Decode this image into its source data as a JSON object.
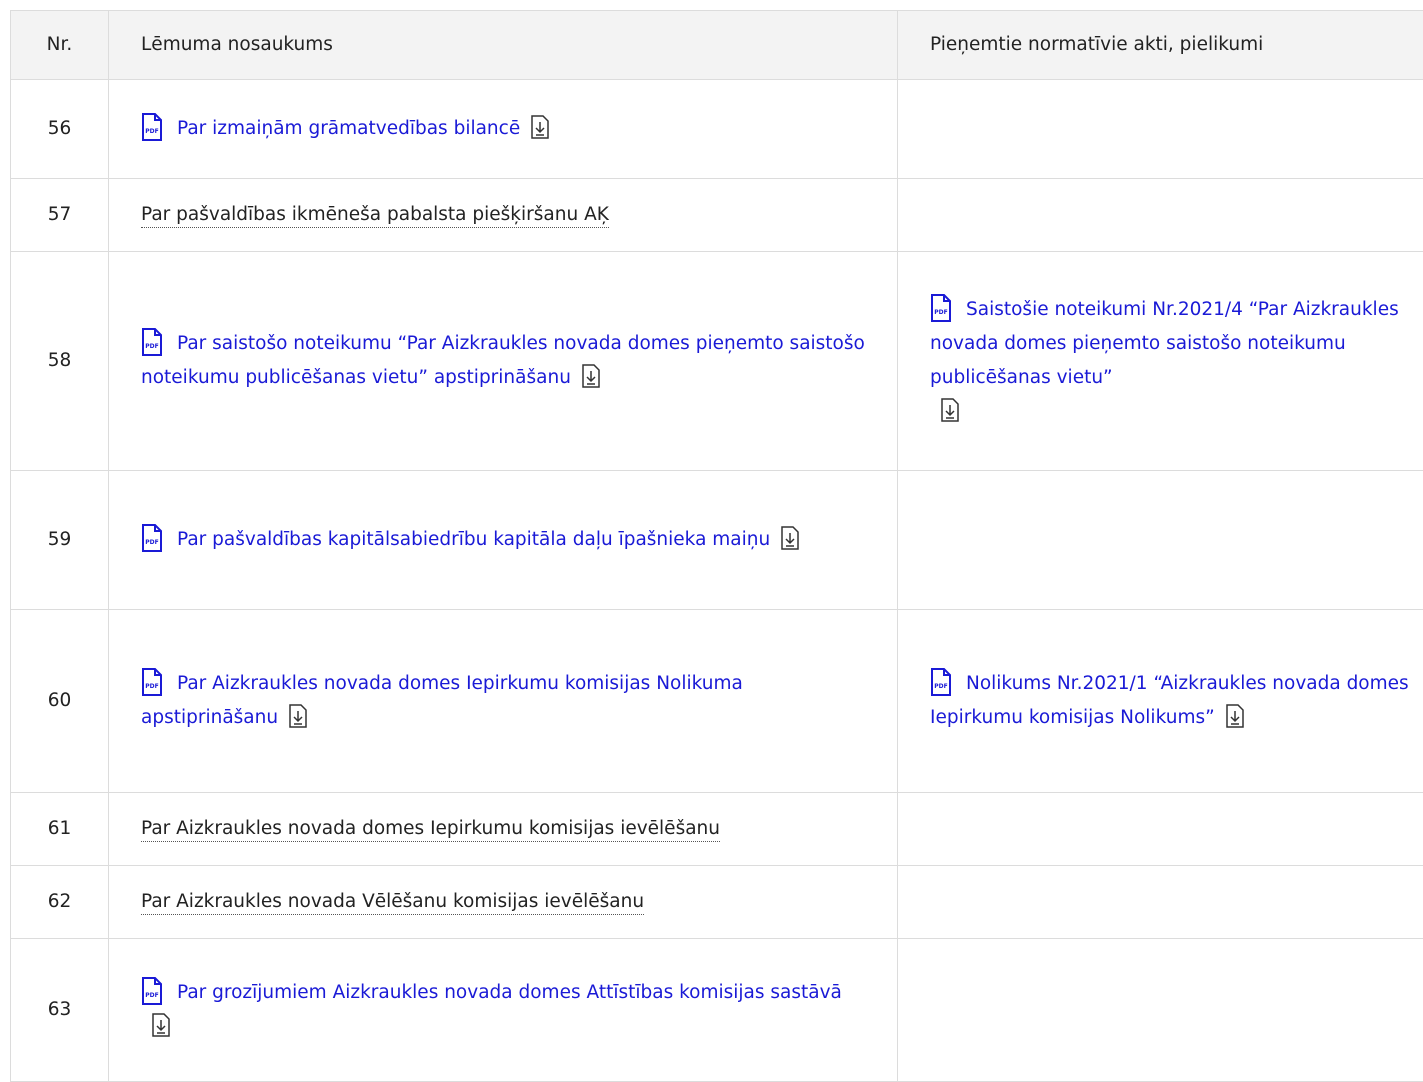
{
  "table": {
    "headers": {
      "nr": "Nr.",
      "title": "Lēmuma nosaukums",
      "attachments": "Pieņemtie normatīvie akti, pielikumi"
    },
    "rows": [
      {
        "nr": "56",
        "title": "Par izmaiņām grāmatvedības bilancē",
        "title_is_link": true,
        "attachment": ""
      },
      {
        "nr": "57",
        "title": "Par pašvaldības ikmēneša pabalsta piešķiršanu AĶ",
        "title_is_link": false,
        "attachment": ""
      },
      {
        "nr": "58",
        "title": "Par saistošo noteikumu “Par Aizkraukles novada domes pieņemto saistošo noteikumu publicēšanas vietu” apstiprināšanu",
        "title_is_link": true,
        "attachment": "Saistošie noteikumi Nr.2021/4 “Par Aizkraukles novada domes pieņemto saistošo noteikumu publicēšanas vietu”"
      },
      {
        "nr": "59",
        "title": "Par pašvaldības kapitālsabiedrību kapitāla daļu īpašnieka maiņu",
        "title_is_link": true,
        "attachment": ""
      },
      {
        "nr": "60",
        "title": "Par Aizkraukles novada domes Iepirkumu komisijas Nolikuma apstiprināšanu",
        "title_is_link": true,
        "attachment": "Nolikums Nr.2021/1 “Aizkraukles novada domes Iepirkumu komisijas Nolikums”"
      },
      {
        "nr": "61",
        "title": "Par Aizkraukles novada domes Iepirkumu komisijas ievēlēšanu",
        "title_is_link": false,
        "attachment": ""
      },
      {
        "nr": "62",
        "title": "Par Aizkraukles novada Vēlēšanu komisijas ievēlēšanu",
        "title_is_link": false,
        "attachment": ""
      },
      {
        "nr": "63",
        "title": "Par grozījumiem Aizkraukles novada domes Attīstības komisijas sastāvā",
        "title_is_link": true,
        "attachment": ""
      }
    ]
  },
  "icons": {
    "pdf": "pdf-file-icon",
    "download": "download-icon"
  },
  "colors": {
    "link": "#1a1ad6",
    "header_bg": "#f3f3f3",
    "border": "#dcdcdc"
  }
}
